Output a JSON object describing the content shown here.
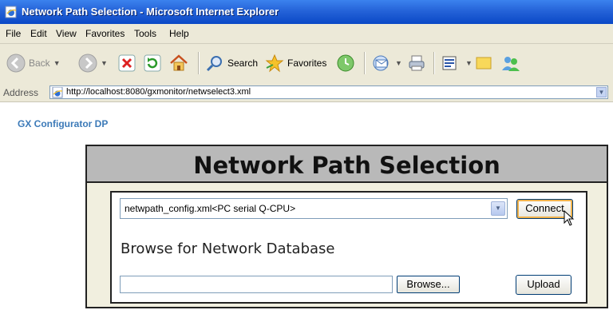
{
  "window": {
    "title": "Network Path Selection - Microsoft Internet Explorer"
  },
  "menu": {
    "items": [
      "File",
      "Edit",
      "View",
      "Favorites",
      "Tools",
      "Help"
    ]
  },
  "toolbar": {
    "back_label": "Back",
    "search_label": "Search",
    "favorites_label": "Favorites"
  },
  "address": {
    "label": "Address",
    "url": "http://localhost:8080/gxmonitor/netwselect3.xml"
  },
  "page": {
    "brand": "GX Configurator DP",
    "title": "Network Path Selection",
    "network_select": {
      "selected": "netwpath_config.xml<PC serial Q-CPU>"
    },
    "connect_label": "Connect",
    "browse_heading": "Browse for Network Database",
    "file_input": {
      "value": ""
    },
    "browse_label": "Browse...",
    "upload_label": "Upload"
  },
  "colors": {
    "titlebar": "#2563d8",
    "brand": "#3c7ab8",
    "panel_header": "#b9b9b9",
    "panel_bg": "#f1efdf"
  }
}
